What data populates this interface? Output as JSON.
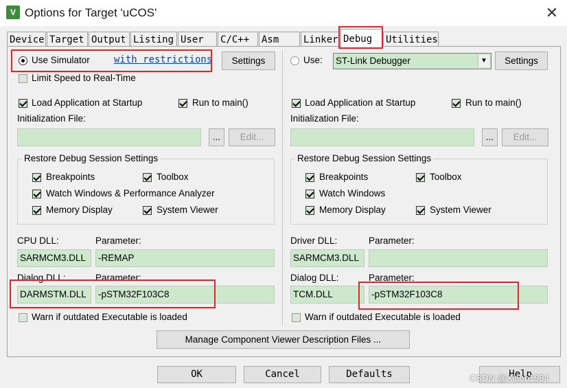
{
  "window": {
    "title": "Options for Target 'uCOS'",
    "icon_char": "V",
    "close_glyph": "✕"
  },
  "tabs": [
    {
      "label": "Device"
    },
    {
      "label": "Target"
    },
    {
      "label": "Output"
    },
    {
      "label": "Listing"
    },
    {
      "label": "User"
    },
    {
      "label": "C/C++"
    },
    {
      "label": "Asm"
    },
    {
      "label": "Linker"
    },
    {
      "label": "Debug",
      "active": true
    },
    {
      "label": "Utilities"
    }
  ],
  "left": {
    "use_simulator": {
      "label": "Use Simulator",
      "checked": true
    },
    "restrictions_link": "with restrictions",
    "settings_label": "Settings",
    "limit_speed": {
      "label": "Limit Speed to Real-Time",
      "checked": false
    },
    "load_app": {
      "label": "Load Application at Startup",
      "checked": true
    },
    "run_to_main": {
      "label": "Run to main()",
      "checked": true
    },
    "init_file_label": "Initialization File:",
    "init_file_value": "",
    "browse_label": "...",
    "edit_label": "Edit...",
    "restore_group_title": "Restore Debug Session Settings",
    "restore": {
      "breakpoints": {
        "label": "Breakpoints",
        "checked": true
      },
      "toolbox": {
        "label": "Toolbox",
        "checked": true
      },
      "watch": {
        "label": "Watch Windows & Performance Analyzer",
        "checked": true
      },
      "memory": {
        "label": "Memory Display",
        "checked": true
      },
      "system_viewer": {
        "label": "System Viewer",
        "checked": true
      }
    },
    "cpu_dll_label": "CPU DLL:",
    "cpu_dll": "SARMCM3.DLL",
    "cpu_param_label": "Parameter:",
    "cpu_param": "-REMAP",
    "dialog_dll_label": "Dialog DLL:",
    "dialog_dll": "DARMSTM.DLL",
    "dialog_param_label": "Parameter:",
    "dialog_param": "-pSTM32F103C8",
    "warn": {
      "label": "Warn if outdated Executable is loaded",
      "checked": false
    }
  },
  "right": {
    "use": {
      "label": "Use:",
      "checked": false
    },
    "debugger_select": "ST-Link Debugger",
    "settings_label": "Settings",
    "load_app": {
      "label": "Load Application at Startup",
      "checked": true
    },
    "run_to_main": {
      "label": "Run to main()",
      "checked": true
    },
    "init_file_label": "Initialization File:",
    "init_file_value": "",
    "browse_label": "...",
    "edit_label": "Edit...",
    "restore_group_title": "Restore Debug Session Settings",
    "restore": {
      "breakpoints": {
        "label": "Breakpoints",
        "checked": true
      },
      "toolbox": {
        "label": "Toolbox",
        "checked": true
      },
      "watch": {
        "label": "Watch Windows",
        "checked": true
      },
      "memory": {
        "label": "Memory Display",
        "checked": true
      },
      "system_viewer": {
        "label": "System Viewer",
        "checked": true
      }
    },
    "driver_dll_label": "Driver DLL:",
    "driver_dll": "SARMCM3.DLL",
    "driver_param_label": "Parameter:",
    "driver_param": "",
    "dialog_dll_label": "Dialog DLL:",
    "dialog_dll": "TCM.DLL",
    "dialog_param_label": "Parameter:",
    "dialog_param": "-pSTM32F103C8",
    "warn": {
      "label": "Warn if outdated Executable is loaded",
      "checked": false
    }
  },
  "manage_button": "Manage Component Viewer Description Files ...",
  "buttons": {
    "ok": "OK",
    "cancel": "Cancel",
    "defaults": "Defaults",
    "help": "Help"
  },
  "watermark": "CSDN @Xiaoh1984",
  "colors": {
    "field_green": "#cde8cc",
    "highlight_red": "#e02525",
    "link_blue": "#0645ad"
  }
}
